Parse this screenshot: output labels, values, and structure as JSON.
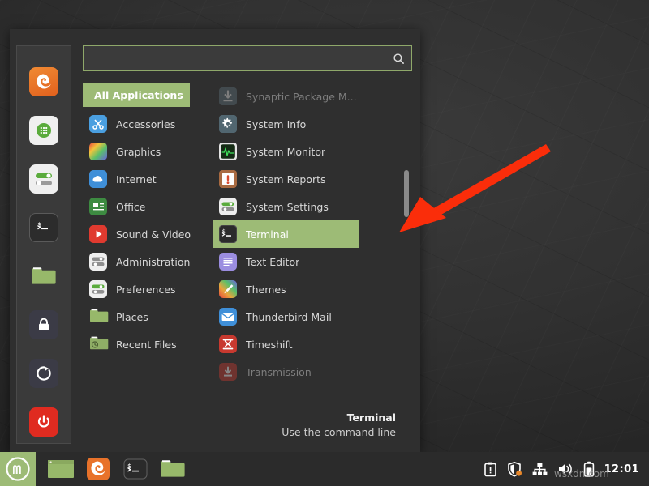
{
  "desktop": {
    "name": "linux-mint-desktop"
  },
  "menu": {
    "search": {
      "value": "",
      "placeholder": "",
      "icon": "search-icon"
    },
    "all_applications_label": "All Applications",
    "favorites": [
      {
        "name": "firefox-icon",
        "label": "Firefox Web Browser",
        "color": "#e8722a"
      },
      {
        "name": "software-manager-icon",
        "label": "Software Manager",
        "color": "#f2f2f2"
      },
      {
        "name": "system-settings-icon",
        "label": "System Settings",
        "color": "#f2f2f2"
      },
      {
        "name": "terminal-icon",
        "label": "Terminal",
        "color": "#2e2e2e"
      },
      {
        "name": "files-icon",
        "label": "Files",
        "color": "#97b86a"
      },
      {
        "name": "lock-screen-icon",
        "label": "Lock Screen",
        "color": "#383844"
      },
      {
        "name": "log-out-icon",
        "label": "Log Out",
        "color": "#383844"
      },
      {
        "name": "quit-icon",
        "label": "Quit",
        "color": "#e02b20"
      }
    ],
    "categories": [
      {
        "label": "Accessories",
        "icon": "scissors-icon"
      },
      {
        "label": "Graphics",
        "icon": "palette-icon"
      },
      {
        "label": "Internet",
        "icon": "cloud-icon"
      },
      {
        "label": "Office",
        "icon": "document-icon"
      },
      {
        "label": "Sound & Video",
        "icon": "play-icon"
      },
      {
        "label": "Administration",
        "icon": "sliders-icon"
      },
      {
        "label": "Preferences",
        "icon": "toggle-icon"
      },
      {
        "label": "Places",
        "icon": "folder-icon"
      },
      {
        "label": "Recent Files",
        "icon": "recent-clock-icon"
      }
    ],
    "applications": [
      {
        "label": "Synaptic Package M...",
        "icon": "download-arrow-icon",
        "state": "dim"
      },
      {
        "label": "System Info",
        "icon": "gear-icon",
        "state": "normal"
      },
      {
        "label": "System Monitor",
        "icon": "pulse-icon",
        "state": "normal"
      },
      {
        "label": "System Reports",
        "icon": "alert-icon",
        "state": "normal"
      },
      {
        "label": "System Settings",
        "icon": "toggle-icon",
        "state": "normal"
      },
      {
        "label": "Terminal",
        "icon": "terminal-icon",
        "state": "selected"
      },
      {
        "label": "Text Editor",
        "icon": "text-lines-icon",
        "state": "normal"
      },
      {
        "label": "Themes",
        "icon": "brush-icon",
        "state": "normal"
      },
      {
        "label": "Thunderbird Mail",
        "icon": "envelope-icon",
        "state": "normal"
      },
      {
        "label": "Timeshift",
        "icon": "timeshift-icon",
        "state": "normal"
      },
      {
        "label": "Transmission",
        "icon": "transmission-icon",
        "state": "dim"
      }
    ],
    "footer": {
      "title": "Terminal",
      "description": "Use the command line"
    }
  },
  "taskbar": {
    "menu_button": {
      "name": "mint-menu-button",
      "label": "Menu"
    },
    "window_items": [
      {
        "name": "window-button-files",
        "label": "Files"
      },
      {
        "name": "window-button-firefox",
        "label": "Firefox"
      },
      {
        "name": "window-button-terminal",
        "label": "Terminal"
      },
      {
        "name": "window-button-folder",
        "label": "Home"
      }
    ],
    "tray": [
      {
        "name": "update-manager-icon",
        "label": "Update Manager"
      },
      {
        "name": "shield-icon",
        "label": "Firewall"
      },
      {
        "name": "network-icon",
        "label": "Network"
      },
      {
        "name": "volume-icon",
        "label": "Volume"
      },
      {
        "name": "battery-icon",
        "label": "Battery"
      }
    ],
    "clock": "12:01"
  },
  "annotation": {
    "arrow_color": "#fa2d0a",
    "name": "red-pointer-arrow"
  },
  "watermark": "wsxdn.com",
  "colors": {
    "accent_green": "#9dbb76",
    "panel_bg": "#2f2f2f",
    "taskbar_bg": "#2b2b2b",
    "text": "#d8d8d8"
  }
}
